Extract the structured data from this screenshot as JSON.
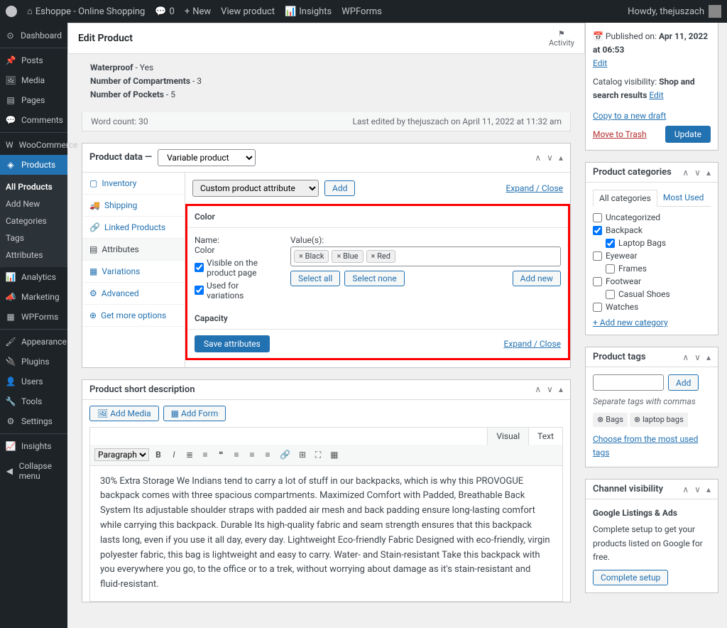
{
  "adminbar": {
    "site_name": "Eshoppe - Online Shopping",
    "comments": "0",
    "new": "New",
    "view_product": "View product",
    "insights": "Insights",
    "wpforms": "WPForms",
    "greeting": "Howdy, thejuszach"
  },
  "sidebar": {
    "dashboard": "Dashboard",
    "posts": "Posts",
    "media": "Media",
    "pages": "Pages",
    "comments": "Comments",
    "woocommerce": "WooCommerce",
    "products": "Products",
    "submenu": {
      "all": "All Products",
      "add": "Add New",
      "categories": "Categories",
      "tags": "Tags",
      "attributes": "Attributes"
    },
    "analytics": "Analytics",
    "marketing": "Marketing",
    "wpforms": "WPForms",
    "appearance": "Appearance",
    "plugins": "Plugins",
    "users": "Users",
    "tools": "Tools",
    "settings": "Settings",
    "insights": "Insights",
    "collapse": "Collapse menu"
  },
  "page": {
    "title": "Edit Product",
    "activity": "Activity"
  },
  "product_meta": {
    "waterproof_label": "Waterproof",
    "waterproof_value": " - Yes",
    "compartments_label": "Number of Compartments",
    "compartments_value": " - 3",
    "pockets_label": "Number of Pockets",
    "pockets_value": " - 5"
  },
  "footer_bar": {
    "word_count": "Word count: 30",
    "last_edited": "Last edited by thejuszach on April 11, 2022 at 11:32 am"
  },
  "product_data": {
    "header_label": "Product data —",
    "type_option": "Variable product",
    "tabs": {
      "inventory": "Inventory",
      "shipping": "Shipping",
      "linked": "Linked Products",
      "attributes": "Attributes",
      "variations": "Variations",
      "advanced": "Advanced",
      "more": "Get more options"
    },
    "attribute_select": "Custom product attribute",
    "add_btn": "Add",
    "expand": "Expand / Close",
    "color_head": "Color",
    "name_label": "Name:",
    "name_value": "Color",
    "visible_label": "Visible on the product page",
    "used_label": "Used for variations",
    "values_label": "Value(s):",
    "tags": {
      "black": "Black",
      "blue": "Blue",
      "red": "Red"
    },
    "select_all": "Select all",
    "select_none": "Select none",
    "add_new": "Add new",
    "capacity_head": "Capacity",
    "save_btn": "Save attributes"
  },
  "short_desc": {
    "title": "Product short description",
    "add_media": "Add Media",
    "add_form": "Add Form",
    "visual": "Visual",
    "text": "Text",
    "paragraph": "Paragraph",
    "body": "30% Extra Storage We Indians tend to carry a lot of stuff in our backpacks, which is why this PROVOGUE backpack comes with three spacious compartments. Maximized Comfort with Padded, Breathable Back System Its adjustable shoulder straps with padded air mesh and back padding ensure long-lasting comfort while carrying this backpack. Durable Its high-quality fabric and seam strength ensures that this backpack lasts long, even if you use it all day, every day. Lightweight Eco-friendly Fabric Designed with eco-friendly, virgin polyester fabric, this bag is lightweight and easy to carry. Water- and Stain-resistant Take this backpack with you everywhere you go, to the office or to a trek, without worrying about damage as it's stain-resistant and fluid-resistant."
  },
  "publish": {
    "published_on_label": "Published on: ",
    "published_on_value": "Apr 11, 2022 at 06:53",
    "edit": "Edit",
    "visibility_label": "Catalog visibility: ",
    "visibility_value": "Shop and search results",
    "copy_draft": "Copy to a new draft",
    "move_trash": "Move to Trash",
    "update": "Update"
  },
  "categories": {
    "title": "Product categories",
    "all_tab": "All categories",
    "most_used": "Most Used",
    "uncategorized": "Uncategorized",
    "backpack": "Backpack",
    "laptop": "Laptop Bags",
    "eyewear": "Eyewear",
    "frames": "Frames",
    "footwear": "Footwear",
    "casual": "Casual Shoes",
    "watches": "Watches",
    "add_new": "+ Add new category"
  },
  "tags_box": {
    "title": "Product tags",
    "add": "Add",
    "hint": "Separate tags with commas",
    "bags": "Bags",
    "laptop_bags": "laptop bags",
    "choose": "Choose from the most used tags"
  },
  "channel": {
    "title": "Channel visibility",
    "glabel": "Google Listings & Ads",
    "desc": "Complete setup to get your products listed on Google for free.",
    "btn": "Complete setup"
  }
}
